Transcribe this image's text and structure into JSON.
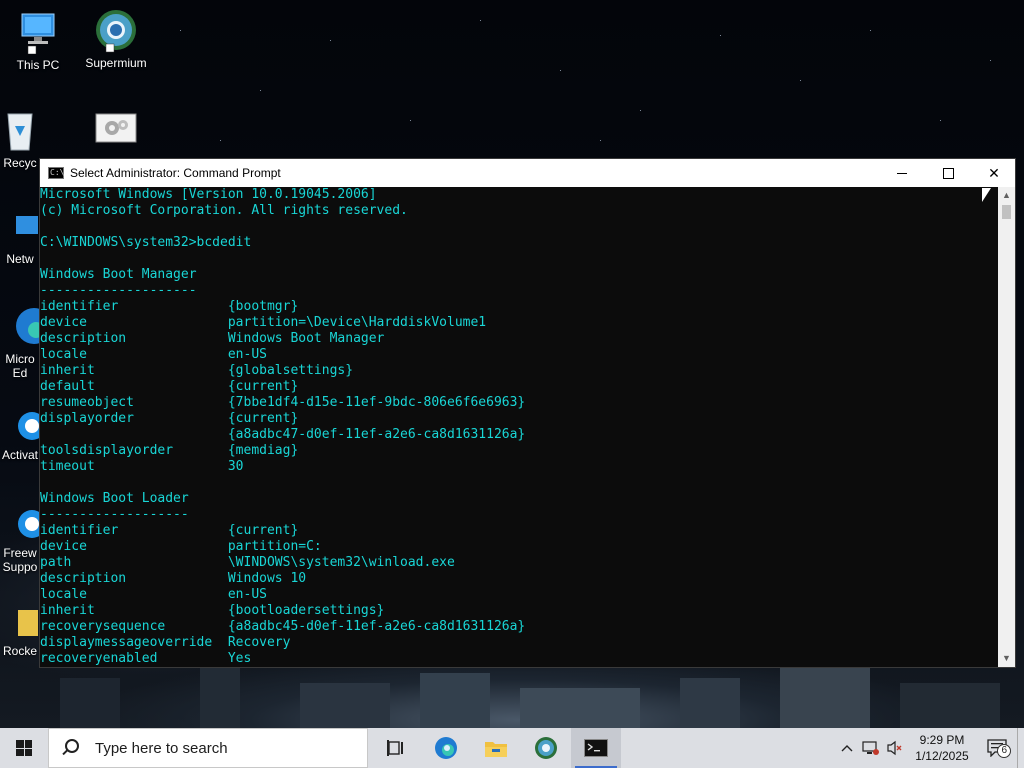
{
  "desktop": {
    "icons": [
      {
        "label": "This PC"
      },
      {
        "label": "Supermium"
      },
      {
        "label": "Recyc"
      },
      {
        "label": ""
      },
      {
        "label": "Netw"
      },
      {
        "label": "Micro"
      },
      {
        "label": "Ed"
      },
      {
        "label": "Activat"
      },
      {
        "label": "Freew"
      },
      {
        "label": "Suppo"
      },
      {
        "label": "Rocke"
      }
    ]
  },
  "cmd_window": {
    "title": "Select Administrator: Command Prompt",
    "lines": [
      "Microsoft Windows [Version 10.0.19045.2006]",
      "(c) Microsoft Corporation. All rights reserved.",
      "",
      "C:\\WINDOWS\\system32>bcdedit",
      "",
      "Windows Boot Manager",
      "--------------------",
      "identifier              {bootmgr}",
      "device                  partition=\\Device\\HarddiskVolume1",
      "description             Windows Boot Manager",
      "locale                  en-US",
      "inherit                 {globalsettings}",
      "default                 {current}",
      "resumeobject            {7bbe1df4-d15e-11ef-9bdc-806e6f6e6963}",
      "displayorder            {current}",
      "                        {a8adbc47-d0ef-11ef-a2e6-ca8d1631126a}",
      "toolsdisplayorder       {memdiag}",
      "timeout                 30",
      "",
      "Windows Boot Loader",
      "-------------------",
      "identifier              {current}",
      "device                  partition=C:",
      "path                    \\WINDOWS\\system32\\winload.exe",
      "description             Windows 10",
      "locale                  en-US",
      "inherit                 {bootloadersettings}",
      "recoverysequence        {a8adbc45-d0ef-11ef-a2e6-ca8d1631126a}",
      "displaymessageoverride  Recovery",
      "recoveryenabled         Yes"
    ]
  },
  "taskbar": {
    "search_placeholder": "Type here to search",
    "time": "9:29 PM",
    "date": "1/12/2025",
    "notification_count": "6"
  },
  "colors": {
    "console_text": "#19d6d6",
    "console_bg": "#0c0c0c",
    "taskbar_bg": "#dcdee3"
  }
}
